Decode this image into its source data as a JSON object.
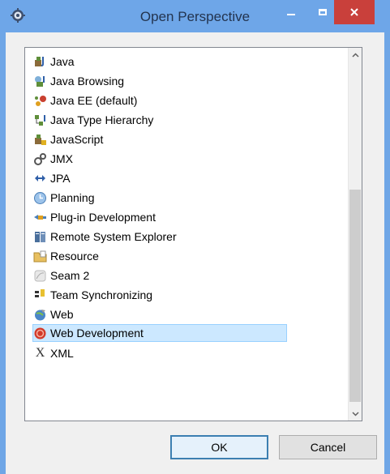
{
  "window": {
    "title": "Open Perspective",
    "colors": {
      "titlebar": "#6ea6e8",
      "close": "#c9403b",
      "selection": "#cce8ff"
    }
  },
  "perspectives": [
    {
      "label": "Java",
      "icon": "java-perspective-icon",
      "selected": false
    },
    {
      "label": "Java Browsing",
      "icon": "java-browsing-icon",
      "selected": false
    },
    {
      "label": "Java EE (default)",
      "icon": "java-ee-icon",
      "selected": false
    },
    {
      "label": "Java Type Hierarchy",
      "icon": "type-hierarchy-icon",
      "selected": false
    },
    {
      "label": "JavaScript",
      "icon": "javascript-icon",
      "selected": false
    },
    {
      "label": "JMX",
      "icon": "jmx-gears-icon",
      "selected": false
    },
    {
      "label": "JPA",
      "icon": "jpa-icon",
      "selected": false
    },
    {
      "label": "Planning",
      "icon": "planning-clock-icon",
      "selected": false
    },
    {
      "label": "Plug-in Development",
      "icon": "plugin-icon",
      "selected": false
    },
    {
      "label": "Remote System Explorer",
      "icon": "remote-system-icon",
      "selected": false
    },
    {
      "label": "Resource",
      "icon": "resource-folder-icon",
      "selected": false
    },
    {
      "label": "Seam 2",
      "icon": "seam-icon",
      "selected": false
    },
    {
      "label": "Team Synchronizing",
      "icon": "team-sync-icon",
      "selected": false
    },
    {
      "label": "Web",
      "icon": "web-globe-icon",
      "selected": false
    },
    {
      "label": "Web Development",
      "icon": "web-development-icon",
      "selected": true
    },
    {
      "label": "XML",
      "icon": "xml-icon",
      "selected": false
    }
  ],
  "buttons": {
    "ok": "OK",
    "cancel": "Cancel"
  }
}
